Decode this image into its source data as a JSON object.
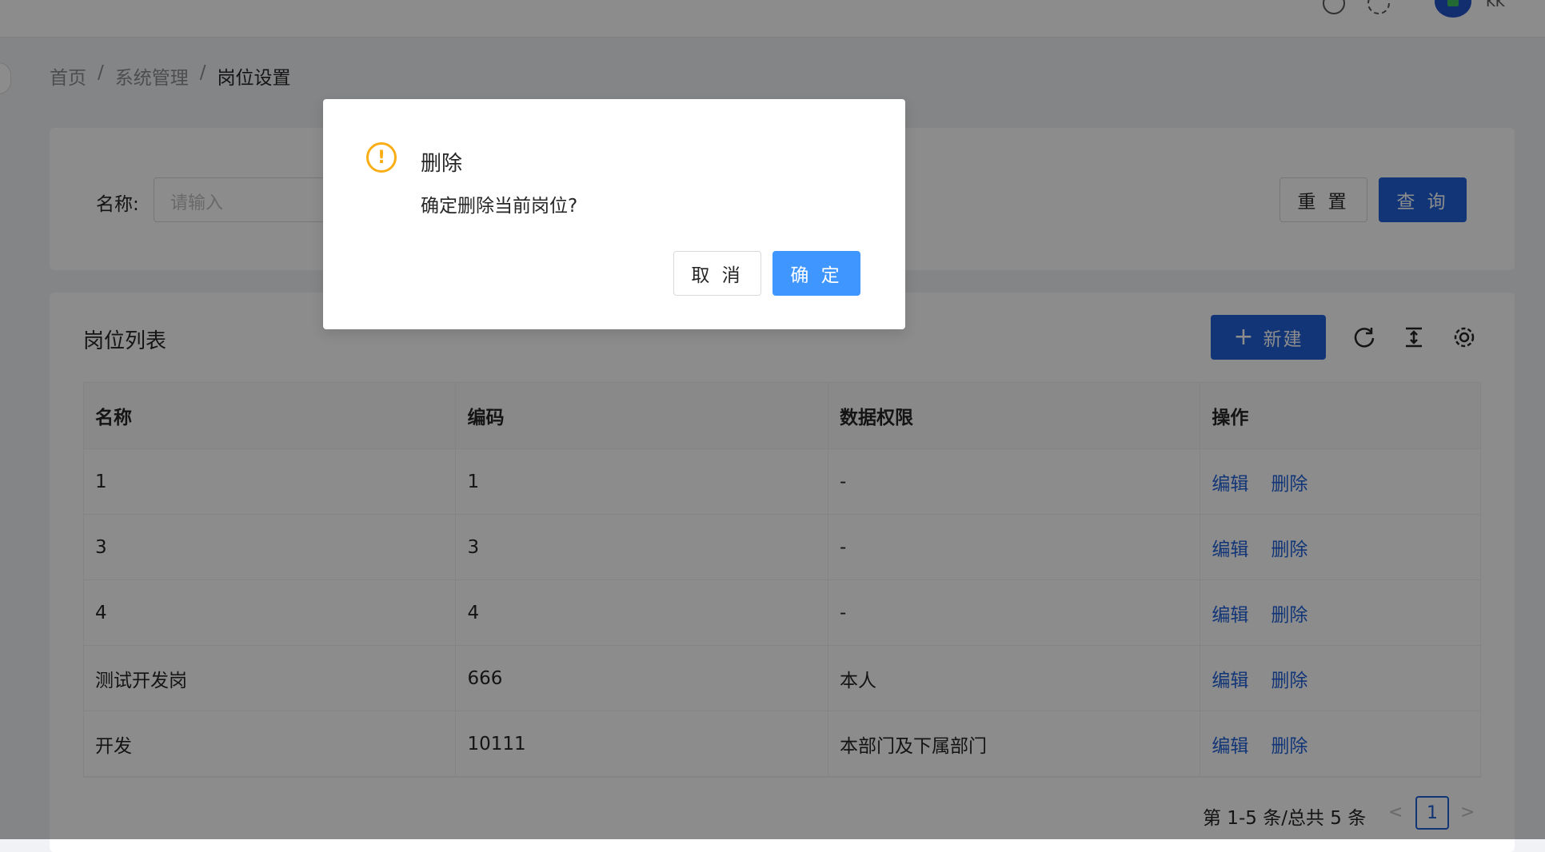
{
  "header": {
    "username": "KK"
  },
  "breadcrumb": {
    "home": "首页",
    "sep1": "/",
    "system": "系统管理",
    "sep2": "/",
    "current": "岗位设置"
  },
  "search": {
    "label": "名称:",
    "placeholder": "请输入",
    "reset_label": "重 置",
    "query_label": "查 询"
  },
  "list": {
    "title": "岗位列表",
    "new_icon": "+",
    "new_label": "新建",
    "columns": [
      "名称",
      "编码",
      "数据权限",
      "操作"
    ],
    "rows": [
      {
        "name": "1",
        "code": "1",
        "scope": "-",
        "edit": "编辑",
        "delete": "删除"
      },
      {
        "name": "3",
        "code": "3",
        "scope": "-",
        "edit": "编辑",
        "delete": "删除"
      },
      {
        "name": "4",
        "code": "4",
        "scope": "-",
        "edit": "编辑",
        "delete": "删除"
      },
      {
        "name": "测试开发岗",
        "code": "666",
        "scope": "本人",
        "edit": "编辑",
        "delete": "删除"
      },
      {
        "name": "开发",
        "code": "10111",
        "scope": "本部门及下属部门",
        "edit": "编辑",
        "delete": "删除"
      }
    ]
  },
  "pagination": {
    "total": "第 1-5 条/总共 5 条",
    "prev": "<",
    "current_page": "1",
    "next": ">"
  },
  "modal": {
    "icon": "!",
    "title": "删除",
    "content": "确定删除当前岗位?",
    "cancel_label": "取 消",
    "ok_label": "确 定"
  },
  "colors": {
    "primary": "#1f61d9",
    "ok_button": "#4096ff",
    "warning": "#faad14"
  },
  "icons": [
    "question-circle-icon",
    "settings-icon",
    "reload-icon",
    "column-height-icon",
    "gear-icon",
    "exclamation-circle-icon"
  ]
}
